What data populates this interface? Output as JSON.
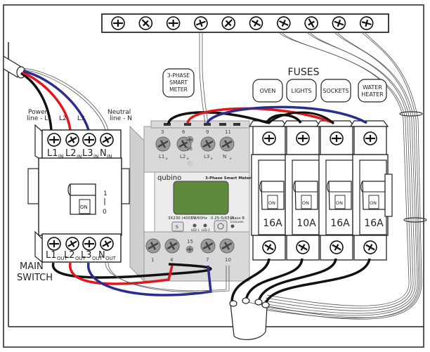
{
  "diagram": {
    "title_fuses": "FUSES",
    "main_switch": {
      "label_line1": "MAIN",
      "label_line2": "SWITCH",
      "handle_label": "ON",
      "position_on": "1",
      "position_off": "0",
      "input_labels": {
        "power_line": "Power",
        "power_line2": "line - L1",
        "l2": "L2",
        "l3": "L3",
        "neutral": "Neutral",
        "neutral2": "line - N"
      },
      "terminals_in": [
        {
          "main": "L1",
          "sub": "IN"
        },
        {
          "main": "L2",
          "sub": "IN"
        },
        {
          "main": "L3",
          "sub": "IN"
        },
        {
          "main": "N",
          "sub": "IN"
        }
      ],
      "terminals_out": [
        {
          "main": "L1",
          "sub": "OUT"
        },
        {
          "main": "L2",
          "sub": "OUT"
        },
        {
          "main": "L3",
          "sub": "OUT"
        },
        {
          "main": "N",
          "sub": "OUT"
        }
      ]
    },
    "smart_meter": {
      "callout_line1": "3-PHASE",
      "callout_line2": "SMART",
      "callout_line3": "METER",
      "brand": "qubino",
      "model": "3-Phase Smart Meter",
      "voltage": "3X230 (400) V",
      "frequency": "50/60Hz",
      "current": "0.25-5(65)A",
      "class": "Class B",
      "impulses": "1000L/kWh",
      "button_s": "S",
      "led1": "LED 1",
      "led2": "LED 2",
      "top_terminals": [
        {
          "num": "3",
          "label": "L1",
          "sub": "o"
        },
        {
          "num": "6",
          "label": "L2",
          "sub": "o"
        },
        {
          "num": "16",
          "label": ""
        },
        {
          "num": "9",
          "label": "L3",
          "sub": "o"
        },
        {
          "num": "11",
          "label": "N",
          "sub": "o"
        }
      ],
      "bottom_terminals": [
        {
          "num": "1"
        },
        {
          "num": "4"
        },
        {
          "num": "15"
        },
        {
          "num": "7"
        },
        {
          "num": "10"
        }
      ]
    },
    "fuses": [
      {
        "name": "OVEN",
        "rating": "16A",
        "handle": "ON"
      },
      {
        "name": "LIGHTS",
        "rating": "10A",
        "handle": "ON"
      },
      {
        "name": "SOCKETS",
        "rating": "16A",
        "handle": "ON"
      },
      {
        "name": "WATER",
        "name2": "HEATER",
        "rating": "16A",
        "handle": "ON"
      }
    ],
    "colors": {
      "wire_l1": "#111111",
      "wire_l2": "#e3161b",
      "wire_l3": "#2b2e8f",
      "meter_body": "#d9d9d9",
      "meter_lcd": "#5f8a3e",
      "outline": "#222222"
    }
  }
}
